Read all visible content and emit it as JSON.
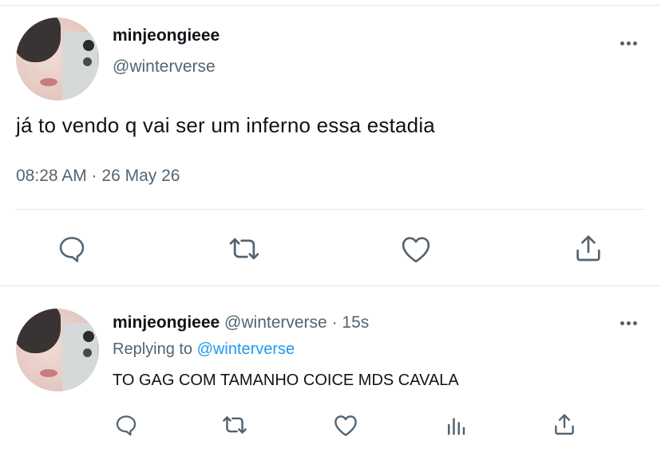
{
  "main_tweet": {
    "display_name": "minjeongieee",
    "handle": "@winterverse",
    "text": "já to vendo q vai ser um inferno essa estadia",
    "timestamp": "08:28 AM · 26 May 26",
    "actions": [
      "reply-icon",
      "retweet-icon",
      "like-icon",
      "share-icon"
    ]
  },
  "reply": {
    "display_name": "minjeongieee",
    "handle": "@winterverse",
    "separator": "·",
    "time_ago": "15s",
    "replying_prefix": "Replying to",
    "replying_to": "@winterverse",
    "text": "TO GAG COM TAMANHO COICE MDS CAVALA",
    "actions": [
      "reply-icon",
      "retweet-icon",
      "like-icon",
      "analytics-icon",
      "share-icon"
    ]
  },
  "colors": {
    "text": "#0f1419",
    "muted": "#536471",
    "link": "#1d9bf0",
    "divider": "#e1e6ea"
  }
}
